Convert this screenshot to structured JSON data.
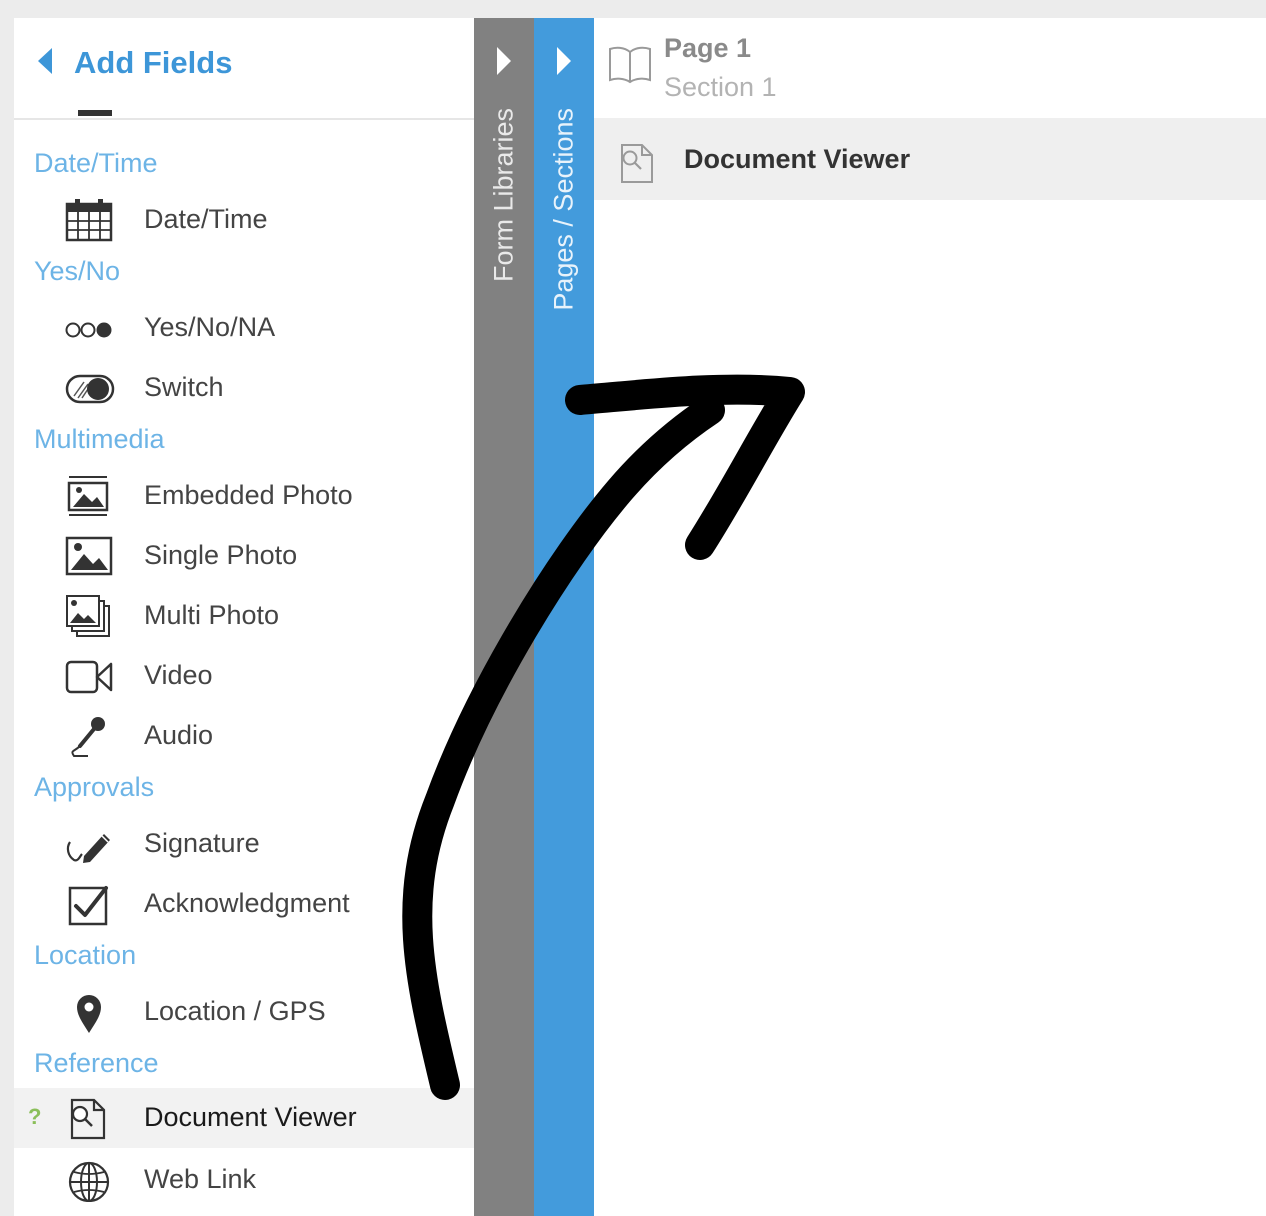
{
  "sidebar": {
    "title": "Add Fields",
    "categories": {
      "datetime": "Date/Time",
      "yesno": "Yes/No",
      "multimedia": "Multimedia",
      "approvals": "Approvals",
      "location": "Location",
      "reference": "Reference"
    },
    "items": {
      "datetime": "Date/Time",
      "yesnona": "Yes/No/NA",
      "switch": "Switch",
      "embedded_photo": "Embedded Photo",
      "single_photo": "Single Photo",
      "multi_photo": "Multi Photo",
      "video": "Video",
      "audio": "Audio",
      "signature": "Signature",
      "acknowledgment": "Acknowledgment",
      "location_gps": "Location / GPS",
      "document_viewer": "Document Viewer",
      "web_link": "Web Link"
    },
    "help_mark": "?"
  },
  "tabs": {
    "form_libraries": "Form Libraries",
    "pages_sections": "Pages / Sections"
  },
  "main": {
    "page_title": "Page 1",
    "section_title": "Section 1",
    "field_label": "Document Viewer"
  },
  "colors": {
    "accent_blue": "#3d96d8",
    "category_blue": "#6db4e6",
    "tab_gray": "#818181",
    "tab_blue": "#439bdc",
    "highlight_row": "#f2f2f2",
    "help_green": "#8bbf5a"
  }
}
